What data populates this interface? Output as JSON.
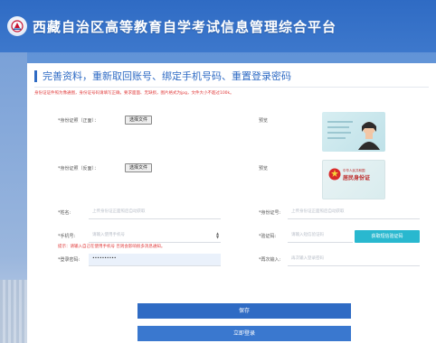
{
  "header": {
    "title": "西藏自治区高等教育自学考试信息管理综合平台"
  },
  "form": {
    "section_title": "完善资料，重新取回账号、绑定手机号码、重置登录密码",
    "notice": "身份证证件照为像通图，身份证号码请填写正确，要求面面、无缺损，图片格式为jpg，文件大小不超过100k。",
    "id_front": {
      "label": "*身份证照（正面）：",
      "button": "选择文件",
      "preview_label": "预览"
    },
    "id_back": {
      "label": "*身份证照（反面）：",
      "button": "选择文件",
      "preview_label": "预览",
      "card_title": "居民身份证",
      "card_subtitle": "中华人民共和国"
    },
    "name": {
      "label": "*姓名:",
      "placeholder": "上传身份证正面照后自动获取"
    },
    "id_number": {
      "label": "*身份证号:",
      "placeholder": "上传身份证正面照后自动获取"
    },
    "phone": {
      "label": "*手机号:",
      "placeholder": "请输入使用手机号"
    },
    "verify_code": {
      "label": "*验证码:",
      "placeholder": "请输入短信验证码",
      "button": "获取短信验证码"
    },
    "phone_hint": "提示：请输入自己在使用手机号 否则会影响很多消息通知。",
    "password": {
      "label": "*登录密码:",
      "value": "••••••••••"
    },
    "confirm_password": {
      "label": "*再次输入:",
      "placeholder": "再次输入登录密码"
    },
    "save_button": "保存",
    "login_button": "立即登录"
  },
  "colors": {
    "header": "#2f6bc4",
    "accent": "#2f6bc4",
    "warning": "#e03a3a",
    "code_button": "#29b8cf"
  }
}
